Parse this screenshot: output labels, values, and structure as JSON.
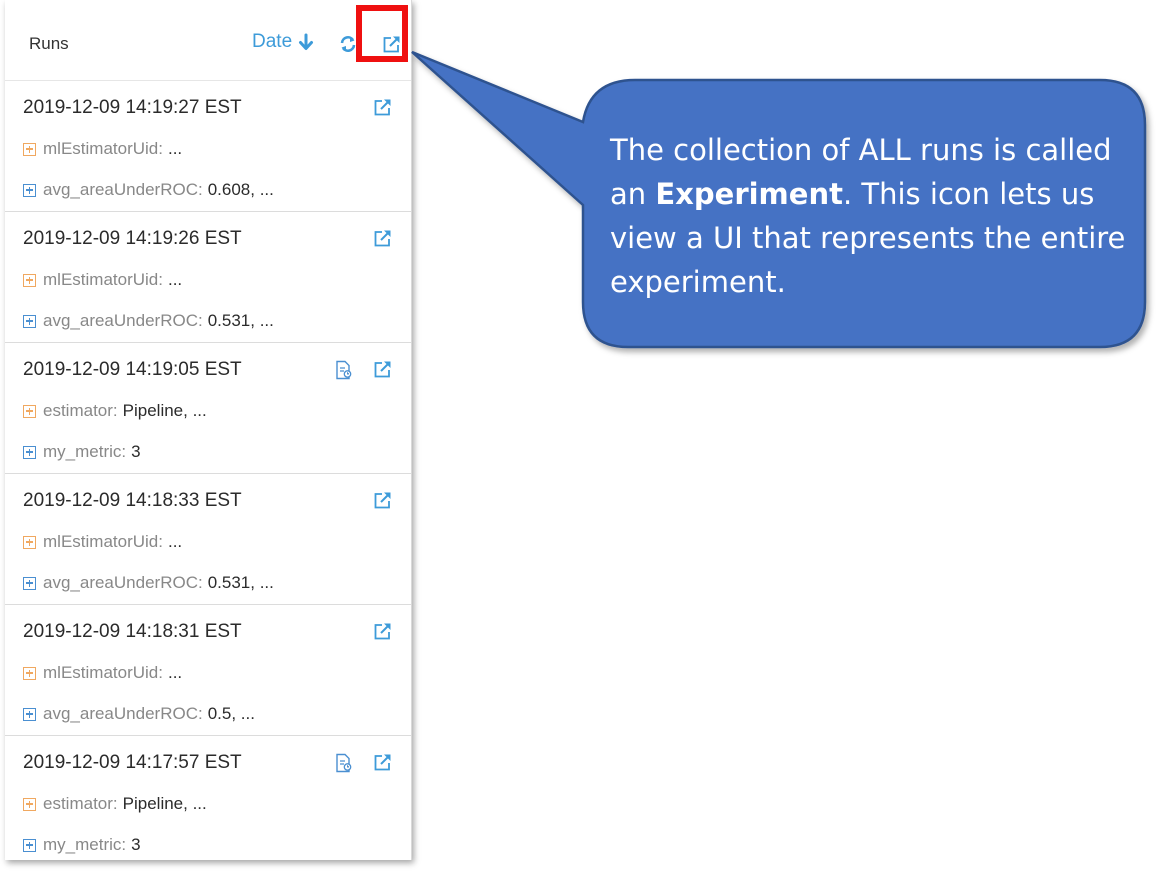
{
  "panel": {
    "title": "Runs",
    "sort_label": "Date",
    "sort_direction_icon": "arrow-down-icon",
    "refresh_icon": "refresh-icon",
    "open_experiment_icon": "external-link-icon"
  },
  "runs": [
    {
      "timestamp": "2019-12-09 14:19:27 EST",
      "param_key": "mlEstimatorUid:",
      "param_value": "...",
      "metric_key": "avg_areaUnderROC:",
      "metric_value": "0.608, ...",
      "has_note": false
    },
    {
      "timestamp": "2019-12-09 14:19:26 EST",
      "param_key": "mlEstimatorUid:",
      "param_value": "...",
      "metric_key": "avg_areaUnderROC:",
      "metric_value": "0.531, ...",
      "has_note": false
    },
    {
      "timestamp": "2019-12-09 14:19:05 EST",
      "param_key": "estimator:",
      "param_value": "Pipeline, ...",
      "metric_key": "my_metric:",
      "metric_value": "3",
      "has_note": true
    },
    {
      "timestamp": "2019-12-09 14:18:33 EST",
      "param_key": "mlEstimatorUid:",
      "param_value": "...",
      "metric_key": "avg_areaUnderROC:",
      "metric_value": "0.531, ...",
      "has_note": false
    },
    {
      "timestamp": "2019-12-09 14:18:31 EST",
      "param_key": "mlEstimatorUid:",
      "param_value": "...",
      "metric_key": "avg_areaUnderROC:",
      "metric_value": "0.5, ...",
      "has_note": false
    },
    {
      "timestamp": "2019-12-09 14:17:57 EST",
      "param_key": "estimator:",
      "param_value": "Pipeline, ...",
      "metric_key": "my_metric:",
      "metric_value": "3",
      "has_note": true
    }
  ],
  "callout": {
    "text_before": "The collection of ALL runs is called an ",
    "bold": "Experiment",
    "text_after": ".  This icon lets us view a UI that represents the entire experiment."
  },
  "colors": {
    "link_blue": "#3d9bd9",
    "highlight_red": "#ef1010",
    "callout_fill": "#4472c4",
    "callout_border": "#2f528f",
    "param_orange": "#f0a860",
    "metric_blue": "#4a8fd1"
  }
}
